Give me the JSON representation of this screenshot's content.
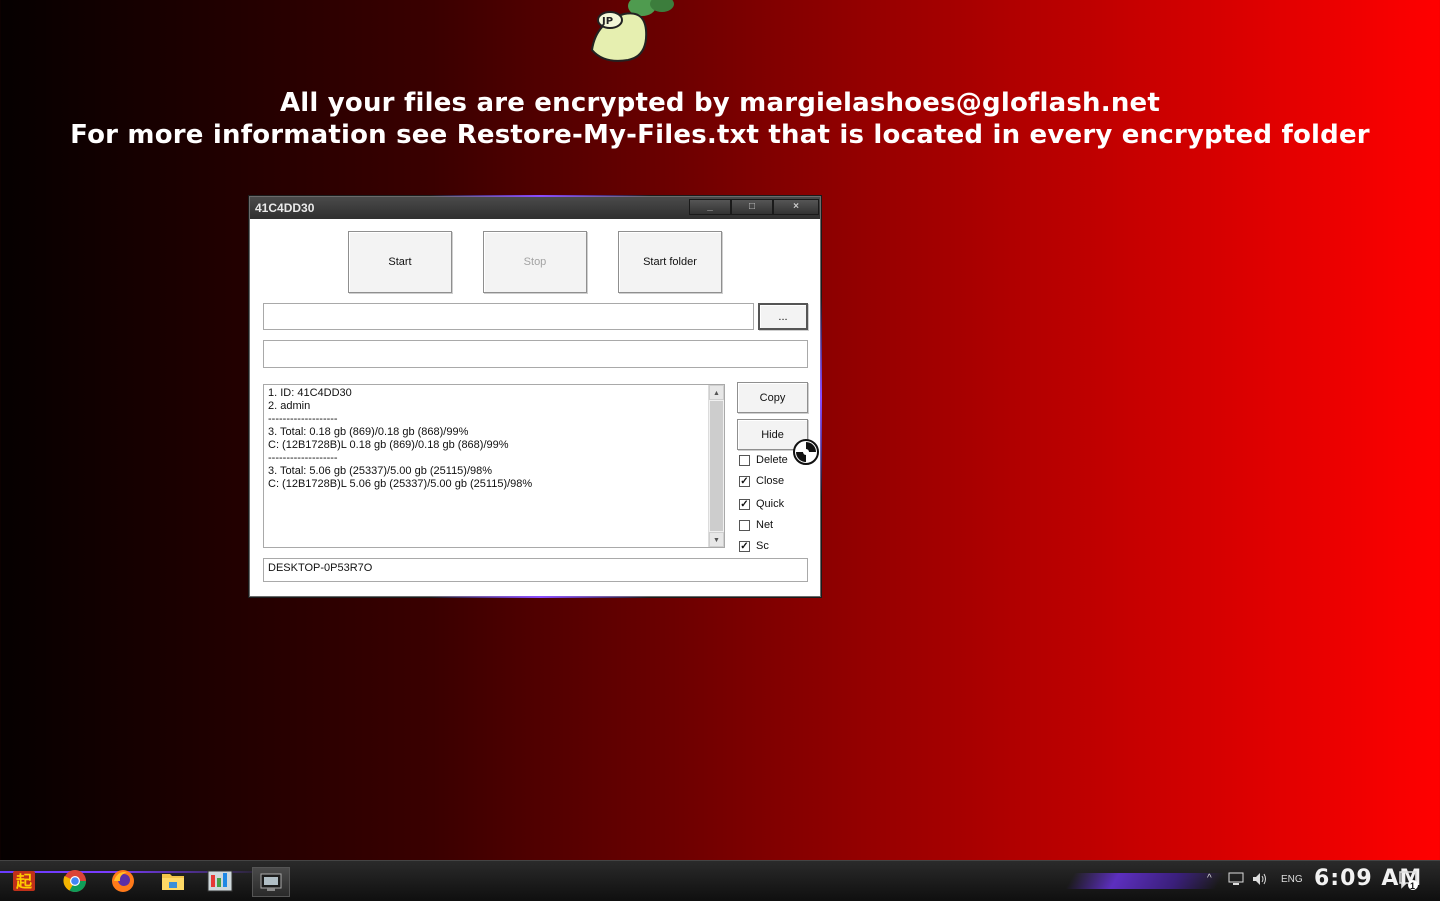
{
  "desktop": {
    "message_line1": "All your files are encrypted by margielashoes@gloflash.net",
    "message_line2": "For more information see Restore-My-Files.txt that is located in every encrypted folder",
    "background_gradient": [
      "#050000",
      "#ff0000"
    ],
    "mascot_label": "JP"
  },
  "window": {
    "title": "41C4DD30",
    "controls": {
      "minimize": "_",
      "maximize": "□",
      "close": "×"
    },
    "buttons": {
      "start": "Start",
      "stop": "Stop",
      "start_folder": "Start folder",
      "browse": "...",
      "copy": "Copy",
      "hide": "Hide"
    },
    "path_input": {
      "value": ""
    },
    "secondary_input": {
      "value": ""
    },
    "log_lines": [
      "1. ID: 41C4DD30",
      "2. admin",
      "-------------------",
      "3. Total: 0.18 gb (869)/0.18 gb (868)/99%",
      "C: (12B1728B)L 0.18 gb (869)/0.18 gb (868)/99%",
      "-------------------",
      "3. Total: 5.06 gb (25337)/5.00 gb (25115)/98%",
      "C: (12B1728B)L 5.06 gb (25337)/5.00 gb (25115)/98%"
    ],
    "options": [
      {
        "label": "Delete",
        "checked": false
      },
      {
        "label": "Close",
        "checked": true
      },
      {
        "label": "Quick",
        "checked": true
      },
      {
        "label": "Net",
        "checked": false
      },
      {
        "label": "Sc",
        "checked": true
      }
    ],
    "status_field": "DESKTOP-0P53R7O"
  },
  "taskbar": {
    "apps": [
      "start-icon",
      "chrome-icon",
      "firefox-icon",
      "file-explorer-icon",
      "task-manager-icon",
      "encryptor-app-icon"
    ],
    "tray": {
      "language": "ENG",
      "notification_count": "1"
    },
    "clock": "6:09 AM"
  }
}
